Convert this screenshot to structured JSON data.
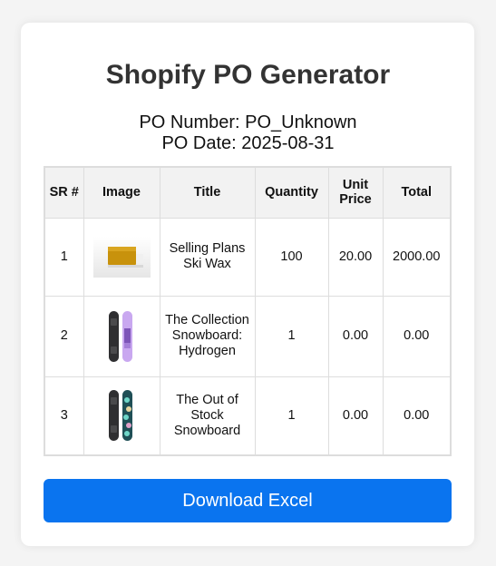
{
  "header": {
    "title": "Shopify PO Generator",
    "po_number": "PO Number: PO_Unknown",
    "po_date": "PO Date: 2025-08-31"
  },
  "table": {
    "columns": {
      "sr": "SR #",
      "image": "Image",
      "title": "Title",
      "quantity": "Quantity",
      "unit_price": "Unit Price",
      "total": "Total"
    },
    "rows": [
      {
        "sr": "1",
        "image_icon": "ski-wax-product-image",
        "title": "Selling Plans Ski Wax",
        "quantity": "100",
        "unit_price": "20.00",
        "total": "2000.00"
      },
      {
        "sr": "2",
        "image_icon": "snowboard-hydrogen-product-image",
        "title": "The Collection Snowboard: Hydrogen",
        "quantity": "1",
        "unit_price": "0.00",
        "total": "0.00"
      },
      {
        "sr": "3",
        "image_icon": "snowboard-out-of-stock-product-image",
        "title": "The Out of Stock Snowboard",
        "quantity": "1",
        "unit_price": "0.00",
        "total": "0.00"
      }
    ]
  },
  "actions": {
    "download_label": "Download Excel"
  },
  "colors": {
    "button_bg": "#0a74ef",
    "header_bg": "#f2f2f2",
    "border": "#dddddd",
    "title_text": "#333333"
  }
}
